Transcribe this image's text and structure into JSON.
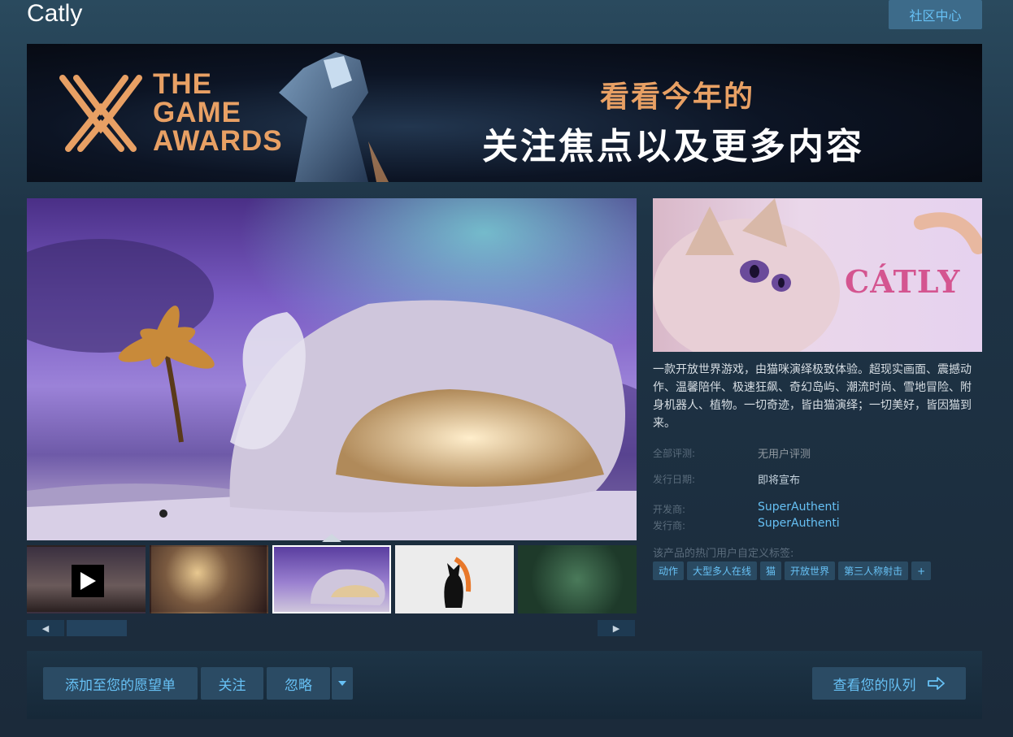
{
  "header": {
    "app_title": "Catly",
    "community_button": "社区中心"
  },
  "banner": {
    "brand_line1": "THE",
    "brand_line2": "GAME",
    "brand_line3": "AWARDS",
    "headline1": "看看今年的",
    "headline2": "关注焦点以及更多内容"
  },
  "media": {
    "thumbnails": [
      {
        "type": "video"
      },
      {
        "type": "screenshot"
      },
      {
        "type": "screenshot",
        "selected": true
      },
      {
        "type": "screenshot"
      },
      {
        "type": "screenshot"
      }
    ],
    "scroll_left": "◀",
    "scroll_right": "▶"
  },
  "capsule": {
    "logo_text": "CÁTLY"
  },
  "info": {
    "description": "一款开放世界游戏，由猫咪演绎极致体验。超现实画面、震撼动作、温馨陪伴、极速狂飙、奇幻岛屿、潮流时尚、雪地冒险、附身机器人、植物。一切奇迹，皆由猫演绎；一切美好，皆因猫到来。",
    "reviews_label": "全部评测:",
    "reviews_value": "无用户评测",
    "release_label": "发行日期:",
    "release_value": "即将宣布",
    "developer_label": "开发商:",
    "developer_value": "SuperAuthenti",
    "publisher_label": "发行商:",
    "publisher_value": "SuperAuthenti",
    "tags_label": "该产品的热门用户自定义标签:",
    "tags": [
      "动作",
      "大型多人在线",
      "猫",
      "开放世界",
      "第三人称射击",
      "+"
    ]
  },
  "actions": {
    "wishlist": "添加至您的愿望单",
    "follow": "关注",
    "ignore": "忽略",
    "queue": "查看您的队列"
  },
  "colors": {
    "accent": "#67c1f5",
    "button_bg": "#2b4b64",
    "banner_orange": "#e8a064"
  }
}
